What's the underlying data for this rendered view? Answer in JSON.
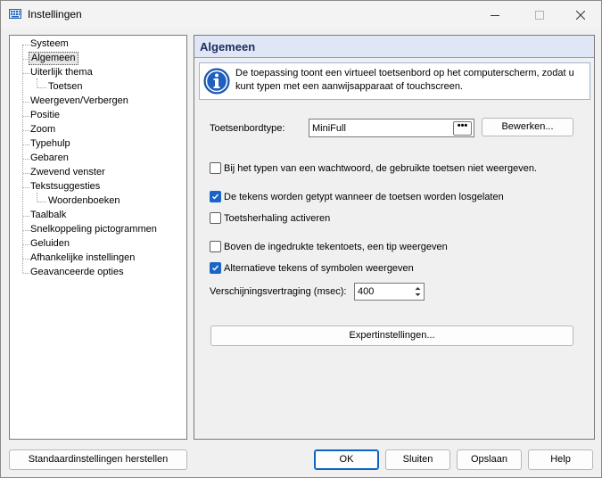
{
  "window": {
    "title": "Instellingen"
  },
  "tree": {
    "items": [
      {
        "label": "Systeem",
        "level": 0
      },
      {
        "label": "Algemeen",
        "level": 0,
        "selected": true
      },
      {
        "label": "Uiterlijk thema",
        "level": 0
      },
      {
        "label": "Toetsen",
        "level": 1
      },
      {
        "label": "Weergeven/Verbergen",
        "level": 0
      },
      {
        "label": "Positie",
        "level": 0
      },
      {
        "label": "Zoom",
        "level": 0
      },
      {
        "label": "Typehulp",
        "level": 0
      },
      {
        "label": "Gebaren",
        "level": 0
      },
      {
        "label": "Zwevend venster",
        "level": 0
      },
      {
        "label": "Tekstsuggesties",
        "level": 0
      },
      {
        "label": "Woordenboeken",
        "level": 1
      },
      {
        "label": "Taalbalk",
        "level": 0
      },
      {
        "label": "Snelkoppeling pictogrammen",
        "level": 0
      },
      {
        "label": "Geluiden",
        "level": 0
      },
      {
        "label": "Afhankelijke instellingen",
        "level": 0
      },
      {
        "label": "Geavanceerde opties",
        "level": 0
      }
    ]
  },
  "panel": {
    "title": "Algemeen",
    "info": "De toepassing toont een virtueel toetsenbord op het computerscherm, zodat u kunt typen met een aanwijsapparaat of touchscreen.",
    "keyboard_type_label": "Toetsenbordtype:",
    "keyboard_type_value": "MiniFull",
    "keyboard_type_button": "•••",
    "edit_button": "Bewerken...",
    "options": [
      {
        "label": "Bij het typen van een wachtwoord, de gebruikte toetsen niet weergeven.",
        "checked": false
      },
      {
        "label": "De tekens worden getypt wanneer de toetsen worden losgelaten",
        "checked": true
      },
      {
        "label": "Toetsherhaling activeren",
        "checked": false
      },
      {
        "label": "Boven de ingedrukte tekentoets, een tip weergeven",
        "checked": false
      },
      {
        "label": "Alternatieve tekens of symbolen weergeven",
        "checked": true
      }
    ],
    "delay_label": "Verschijningsvertraging (msec):",
    "delay_value": "400",
    "expert_button": "Expertinstellingen..."
  },
  "footer": {
    "restore_defaults": "Standaardinstellingen herstellen",
    "ok": "OK",
    "close": "Sluiten",
    "save": "Opslaan",
    "help": "Help"
  }
}
